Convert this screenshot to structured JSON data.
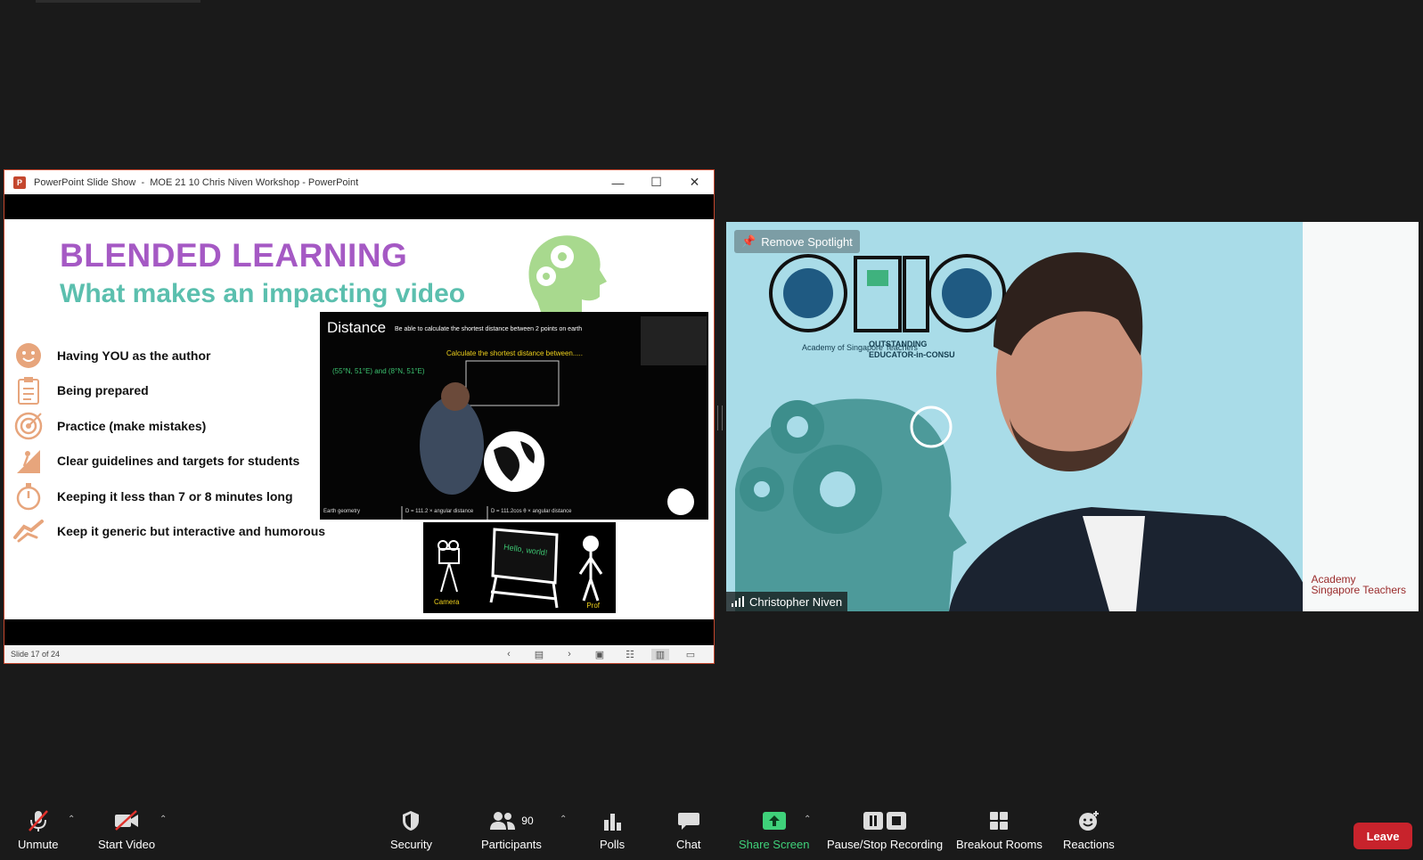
{
  "ppt_window": {
    "title": "PowerPoint Slide Show  -  MOE 21 10 Chris Niven Workshop - PowerPoint",
    "logo_letter": "P",
    "minimize": "—",
    "maximize": "☐",
    "close": "✕",
    "status": {
      "slide_count": "Slide 17 of 24"
    }
  },
  "slide": {
    "heading": "BLENDED LEARNING",
    "subheading": "What makes an impacting video",
    "bullets": [
      "Having YOU as the author",
      "Being prepared",
      "Practice (make mistakes)",
      "Clear guidelines and targets for students",
      "Keeping it less than 7 or 8 minutes long",
      "Keep it generic but interactive and humorous"
    ],
    "video": {
      "title": "Distance",
      "subtitle": "Be able to calculate the shortest distance between 2 points on earth",
      "calc_text": "Calculate the shortest distance between.....",
      "coords": "(55°N, 51°E) and (8°N, 51°E)",
      "foot1": "Earth geometry",
      "foot2": "D = 111.2 × angular distance",
      "foot3": "D = 111.2cos θ × angular distance"
    },
    "cartoon": {
      "board_text": "Hello, world!",
      "camera_label": "Camera",
      "prof_label": "Prof"
    }
  },
  "video_feed": {
    "spotlight_label": "Remove Spotlight",
    "participant_name": "Christopher Niven",
    "oeic_line1": "OUTSTANDING",
    "oeic_line2": "EDUCATOR-in-CONSU",
    "academy_small": "Academy of Singapore Teachers",
    "academy_bottom_1": "Academy",
    "academy_bottom_2": "Singapore Teachers"
  },
  "toolbar": {
    "unmute": "Unmute",
    "start_video": "Start Video",
    "security": "Security",
    "participants": "Participants",
    "participants_count": "90",
    "polls": "Polls",
    "chat": "Chat",
    "share_screen": "Share Screen",
    "recording": "Pause/Stop Recording",
    "breakout": "Breakout Rooms",
    "reactions": "Reactions",
    "leave": "Leave"
  },
  "colors": {
    "heading": "#a559c4",
    "subheading": "#5bbfae",
    "bullet_icon": "#e7a57c",
    "share_green": "#3fd17a",
    "leave_red": "#c8232c"
  }
}
